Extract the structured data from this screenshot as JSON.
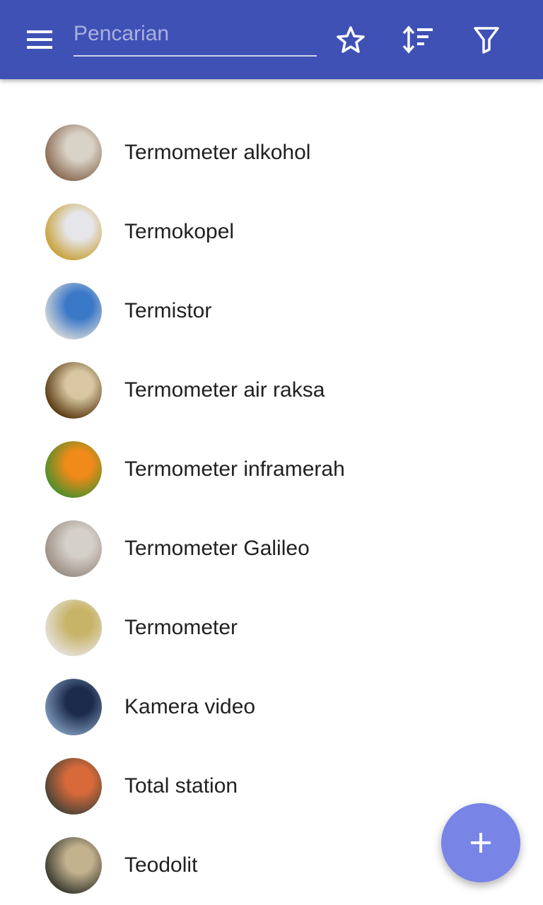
{
  "appbar": {
    "color": "#3f51b5",
    "menu_icon": "menu-icon",
    "search": {
      "placeholder": "Pencarian",
      "value": ""
    },
    "actions": [
      "star-icon",
      "sort-icon",
      "filter-icon"
    ]
  },
  "items": [
    {
      "label": "Termometer alkohol",
      "thumb_colors": [
        "#8a6a52",
        "#d9d2c6"
      ]
    },
    {
      "label": "Termokopel",
      "thumb_colors": [
        "#c9a13a",
        "#e6e6ea"
      ]
    },
    {
      "label": "Termistor",
      "thumb_colors": [
        "#cfd3d8",
        "#3a78c8"
      ]
    },
    {
      "label": "Termometer air raksa",
      "thumb_colors": [
        "#5a3a12",
        "#d8c7a2"
      ]
    },
    {
      "label": "Termometer inframerah",
      "thumb_colors": [
        "#4f8f2c",
        "#f08a18"
      ]
    },
    {
      "label": "Termometer Galileo",
      "thumb_colors": [
        "#9b8e84",
        "#d6d0ca"
      ]
    },
    {
      "label": "Termometer",
      "thumb_colors": [
        "#e4e0d8",
        "#c8b468"
      ]
    },
    {
      "label": "Kamera video",
      "thumb_colors": [
        "#7a94b6",
        "#1c2b4c"
      ]
    },
    {
      "label": "Total station",
      "thumb_colors": [
        "#4a4438",
        "#d86a3a"
      ]
    },
    {
      "label": "Teodolit",
      "thumb_colors": [
        "#3a3a30",
        "#c2b28e"
      ]
    }
  ],
  "fab": {
    "icon": "plus-icon",
    "color": "#7884e6"
  }
}
